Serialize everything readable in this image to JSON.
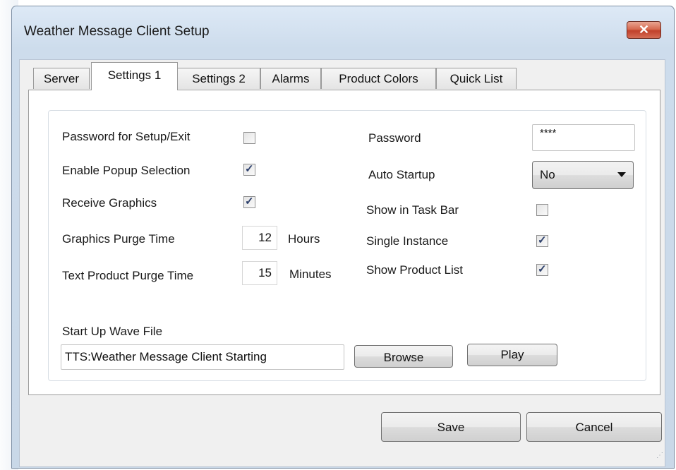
{
  "window": {
    "title": "Weather Message Client Setup",
    "close_glyph": "✕",
    "colors": {
      "chrome": "#cddcec",
      "client": "#f0f0f0",
      "close_button": "#c9573f"
    }
  },
  "tabs": [
    {
      "label": "Server",
      "active": false
    },
    {
      "label": "Settings 1",
      "active": true
    },
    {
      "label": "Settings 2",
      "active": false
    },
    {
      "label": "Alarms",
      "active": false
    },
    {
      "label": "Product Colors",
      "active": false
    },
    {
      "label": "Quick List",
      "active": false
    }
  ],
  "settings": {
    "password_setup_exit": {
      "label": "Password for Setup/Exit",
      "checked": false
    },
    "enable_popup": {
      "label": "Enable Popup Selection",
      "checked": true
    },
    "receive_graphics": {
      "label": "Receive Graphics",
      "checked": true
    },
    "graphics_purge": {
      "label": "Graphics Purge Time",
      "value": "12",
      "unit": "Hours"
    },
    "text_purge": {
      "label": "Text Product Purge Time",
      "value": "15",
      "unit": "Minutes"
    },
    "password": {
      "label": "Password",
      "value": "****"
    },
    "auto_startup": {
      "label": "Auto Startup",
      "value": "No",
      "options": [
        "No"
      ]
    },
    "show_taskbar": {
      "label": "Show in Task Bar",
      "checked": false
    },
    "single_instance": {
      "label": "Single Instance",
      "checked": true
    },
    "show_product_list": {
      "label": "Show Product List",
      "checked": true
    },
    "wave": {
      "label": "Start Up Wave File",
      "value": "TTS:Weather Message Client Starting",
      "browse_label": "Browse",
      "play_label": "Play"
    }
  },
  "footer": {
    "save_label": "Save",
    "cancel_label": "Cancel"
  },
  "icons": {
    "checkmark": "check-icon",
    "dropdown": "chevron-down-icon",
    "close": "close-icon",
    "grip": "resize-grip-icon"
  }
}
